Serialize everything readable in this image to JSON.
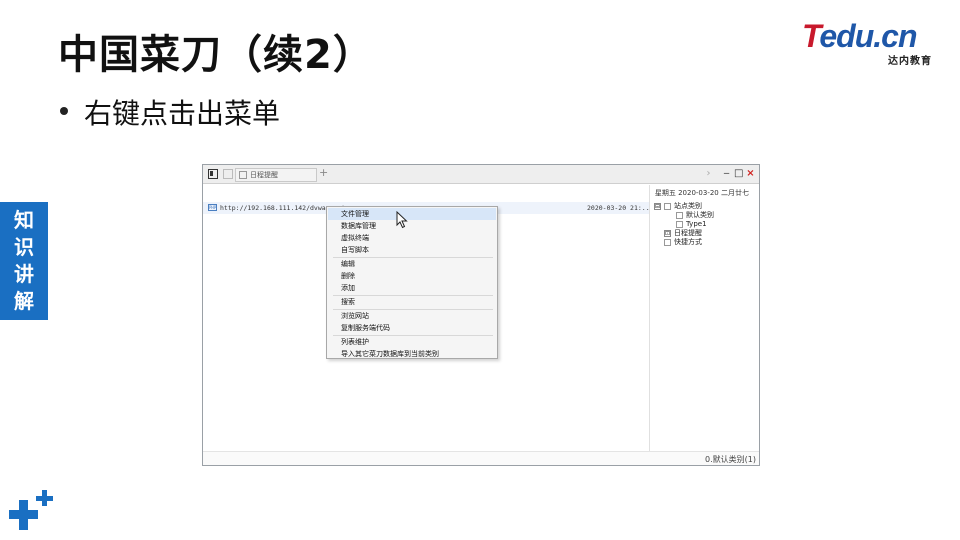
{
  "slide": {
    "title": "中国菜刀（续2）",
    "bullet": "右键点击出菜单",
    "side_tab": [
      "知",
      "识",
      "讲",
      "解"
    ],
    "brand": {
      "logo_t": "T",
      "logo_rest": "edu.cn",
      "sub": "达内教育",
      "color_red": "#c8192c",
      "color_blue": "#1f57a8"
    },
    "accent": "#1a6fc2"
  },
  "app": {
    "tab_label": "日程提醒",
    "add_tab": "+",
    "controls": {
      "chevron": "›",
      "minimize": "‒",
      "maximize": "□",
      "close": "×"
    },
    "url_row": {
      "badge": "PHP",
      "url": "http://192.168.111.142/dvwa-mast",
      "time": "2020-03-20 21:..."
    },
    "date_line": "星期五  2020-03-20  二月廿七",
    "tree": {
      "root": {
        "toggle": "⊟",
        "label": "站点类别"
      },
      "children": [
        "默认类别",
        "Type1"
      ],
      "schedule": {
        "toggle": "⊡",
        "label": "日程提醒"
      },
      "shortcut": {
        "label": "快捷方式"
      }
    },
    "status": "0.默认类别(1)"
  },
  "context_menu": {
    "items": [
      {
        "label": "文件管理",
        "highlight": true
      },
      {
        "label": "数据库管理"
      },
      {
        "label": "虚拟终端"
      },
      {
        "label": "自写脚本"
      },
      {
        "label": "编辑"
      },
      {
        "label": "删除"
      },
      {
        "label": "添加"
      },
      {
        "label": "搜索"
      },
      {
        "label": "浏览网站"
      },
      {
        "label": "复制服务端代码"
      },
      {
        "label": "列表维护"
      },
      {
        "label": "导入其它菜刀数据库到当前类别"
      }
    ]
  }
}
